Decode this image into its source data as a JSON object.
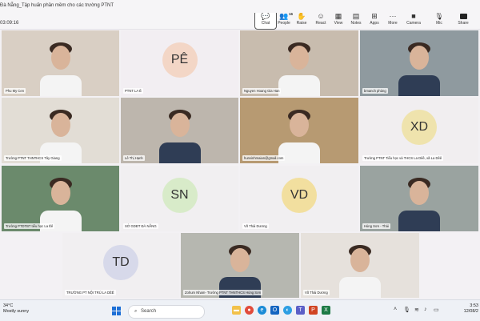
{
  "window": {
    "title": "Đà Nẵng_Tập huấn phần mềm cho các trường PTNT",
    "timer": "03:09:16"
  },
  "toolbar": [
    {
      "key": "chat",
      "label": "Chat",
      "icon": "chat-icon",
      "glyph": "💬"
    },
    {
      "key": "people",
      "label": "People",
      "icon": "people-icon",
      "glyph": "👥",
      "badge": "16"
    },
    {
      "key": "raise",
      "label": "Raise",
      "icon": "raise-hand-icon",
      "glyph": "✋"
    },
    {
      "key": "react",
      "label": "React",
      "icon": "react-icon",
      "glyph": "☺"
    },
    {
      "key": "view",
      "label": "View",
      "icon": "view-icon",
      "glyph": "▦"
    },
    {
      "key": "notes",
      "label": "Notes",
      "icon": "notes-icon",
      "glyph": "▤"
    },
    {
      "key": "apps",
      "label": "Apps",
      "icon": "apps-icon",
      "glyph": "⊞"
    },
    {
      "key": "more",
      "label": "More",
      "icon": "more-icon",
      "glyph": "···"
    },
    {
      "key": "camera",
      "label": "Camera",
      "icon": "camera-icon",
      "glyph": "■"
    },
    {
      "key": "mic",
      "label": "Mic",
      "icon": "mic-icon",
      "glyph": "🎙"
    },
    {
      "key": "share",
      "label": "Share",
      "icon": "share-icon",
      "glyph": ""
    }
  ],
  "tiles": [
    {
      "name": "Phu My Cen",
      "type": "photo"
    },
    {
      "name": "PTNT LA Ê",
      "type": "avatar",
      "initials": "PÊ",
      "color": "#f3d6c6"
    },
    {
      "name": "Nguyen Hoang Gia Han",
      "type": "photo"
    },
    {
      "name": "bmanch phùng",
      "type": "photo"
    },
    {
      "name": "Trường PTNT THNTHCS Tây Giang",
      "type": "photo"
    },
    {
      "name": "Lê Thị Hạnh",
      "type": "photo"
    },
    {
      "name": "hunvinhmaian@gmail.com",
      "type": "photo"
    },
    {
      "name": "Trường PTNT Tiểu học và THCS La Dêê, xã La Dêê",
      "type": "avatar",
      "initials": "XD",
      "color": "#efe3ad"
    },
    {
      "name": "Trường PTDTBT tiểu học La Êê",
      "type": "photo"
    },
    {
      "name": "SỞ GDĐT ĐÀ NẴNG",
      "type": "avatar",
      "initials": "SN",
      "color": "#d8ebc9"
    },
    {
      "name": "Võ Thái Dương",
      "type": "avatar",
      "initials": "VD",
      "color": "#f2df9f"
    },
    {
      "name": "Hùng Sơn - Thái",
      "type": "photo"
    },
    {
      "name": "TRƯỜNG PT NỘI TRÚ LA DÊÊ",
      "type": "avatar",
      "initials": "TD",
      "color": "#d7d9ea"
    },
    {
      "name": "Zohum Nham- Trường PTNT THNTHCS Hùng Sơn",
      "type": "photo"
    },
    {
      "name": "Võ Thái Dương",
      "type": "photo"
    }
  ],
  "taskbar": {
    "temp": "34°C",
    "weather": "Mostly sunny",
    "search_placeholder": "Search",
    "time": "3:53",
    "date": "12/08/2"
  }
}
